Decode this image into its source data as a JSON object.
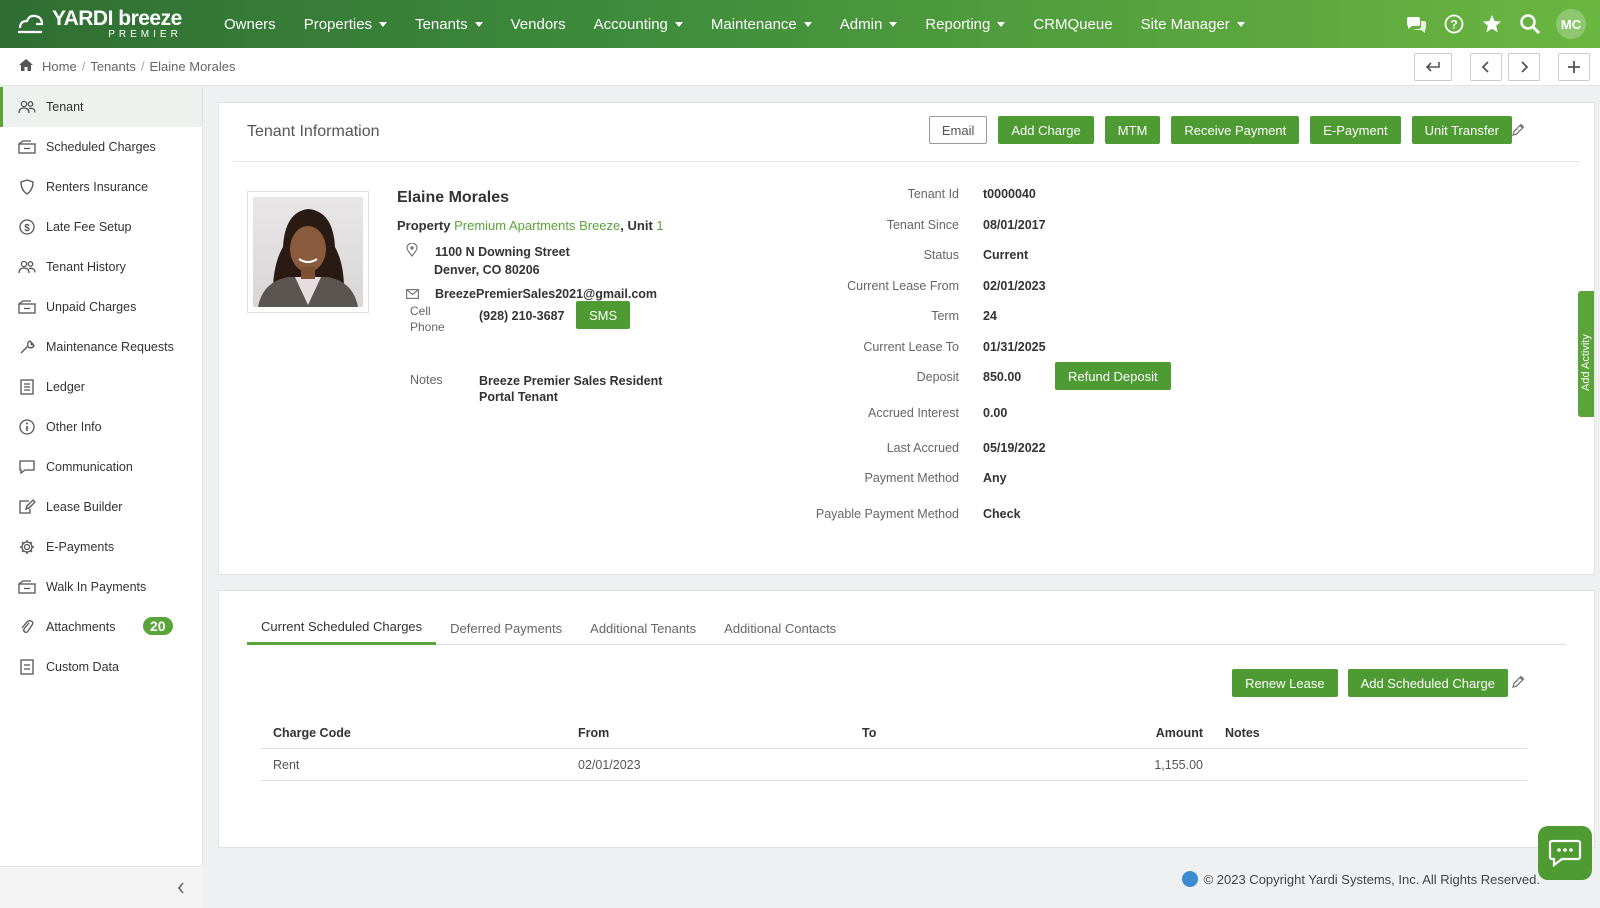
{
  "brand": {
    "name": "YARDI breeze",
    "sub": "PREMIER"
  },
  "nav": [
    {
      "label": "Owners",
      "caret": false
    },
    {
      "label": "Properties",
      "caret": true
    },
    {
      "label": "Tenants",
      "caret": true
    },
    {
      "label": "Vendors",
      "caret": false
    },
    {
      "label": "Accounting",
      "caret": true
    },
    {
      "label": "Maintenance",
      "caret": true
    },
    {
      "label": "Admin",
      "caret": true
    },
    {
      "label": "Reporting",
      "caret": true
    },
    {
      "label": "CRMQueue",
      "caret": false
    },
    {
      "label": "Site Manager",
      "caret": true
    }
  ],
  "user_initials": "MC",
  "breadcrumb": {
    "home": "Home",
    "section": "Tenants",
    "current": "Elaine Morales"
  },
  "sidebar": [
    {
      "label": "Tenant",
      "icon": "users-icon",
      "active": true
    },
    {
      "label": "Scheduled Charges",
      "icon": "charges-icon"
    },
    {
      "label": "Renters Insurance",
      "icon": "shield-icon"
    },
    {
      "label": "Late Fee Setup",
      "icon": "dollar-icon"
    },
    {
      "label": "Tenant History",
      "icon": "users-icon"
    },
    {
      "label": "Unpaid Charges",
      "icon": "charges-icon"
    },
    {
      "label": "Maintenance Requests",
      "icon": "wrench-icon"
    },
    {
      "label": "Ledger",
      "icon": "ledger-icon"
    },
    {
      "label": "Other Info",
      "icon": "info-icon"
    },
    {
      "label": "Communication",
      "icon": "chat-icon"
    },
    {
      "label": "Lease Builder",
      "icon": "edit-doc-icon"
    },
    {
      "label": "E-Payments",
      "icon": "gear-icon"
    },
    {
      "label": "Walk In Payments",
      "icon": "charges-icon"
    },
    {
      "label": "Attachments",
      "icon": "paperclip-icon",
      "badge": "20"
    },
    {
      "label": "Custom Data",
      "icon": "list-icon"
    }
  ],
  "info": {
    "title": "Tenant Information",
    "buttons": {
      "email": "Email",
      "add_charge": "Add Charge",
      "mtm": "MTM",
      "receive_payment": "Receive Payment",
      "epayment": "E-Payment",
      "unit_transfer": "Unit Transfer"
    },
    "name": "Elaine Morales",
    "property_label": "Property",
    "property_name": "Premium Apartments Breeze",
    "unit_label": ", Unit",
    "unit": "1",
    "address1": "1100 N Downing Street",
    "address2": "Denver, CO 80206",
    "email": "BreezePremierSales2021@gmail.com",
    "cell_label_1": "Cell",
    "cell_label_2": "Phone",
    "phone": "(928) 210-3687",
    "sms": "SMS",
    "notes_label": "Notes",
    "notes": "Breeze Premier Sales Resident Portal Tenant",
    "details": [
      {
        "label": "Tenant Id",
        "value": "t0000040"
      },
      {
        "label": "Tenant Since",
        "value": "08/01/2017"
      },
      {
        "label": "Status",
        "value": "Current"
      },
      {
        "label": "Current Lease From",
        "value": "02/01/2023"
      },
      {
        "label": "Term",
        "value": "24"
      },
      {
        "label": "Current Lease To",
        "value": "01/31/2025"
      },
      {
        "label": "Deposit",
        "value": "850.00"
      },
      {
        "label": "Accrued Interest",
        "value": "0.00"
      },
      {
        "label": "Last Accrued",
        "value": "05/19/2022"
      },
      {
        "label": "Payment Method",
        "value": "Any"
      },
      {
        "label": "Payable Payment Method",
        "value": "Check"
      }
    ],
    "refund_deposit": "Refund Deposit",
    "add_activity": "Add Activity"
  },
  "charges": {
    "tabs": [
      "Current Scheduled Charges",
      "Deferred Payments",
      "Additional Tenants",
      "Additional Contacts"
    ],
    "renew_lease": "Renew Lease",
    "add_scheduled_charge": "Add Scheduled Charge",
    "columns": [
      "Charge Code",
      "From",
      "To",
      "Amount",
      "Notes"
    ],
    "rows": [
      [
        "Rent",
        "02/01/2023",
        "",
        "1,155.00",
        ""
      ]
    ]
  },
  "footer": "© 2023 Copyright Yardi Systems, Inc. All Rights Reserved.",
  "colors": {
    "accent": "#4e9a33",
    "nav_start": "#2f6e33",
    "nav_end": "#6bb640"
  }
}
